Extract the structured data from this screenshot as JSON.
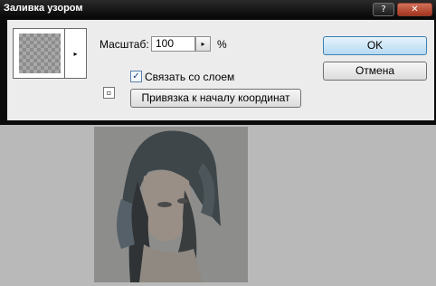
{
  "dialog": {
    "title": "Заливка узором",
    "help_glyph": "?",
    "close_glyph": "✕"
  },
  "pattern_picker": {
    "arrow_glyph": "▸"
  },
  "scale": {
    "label": "Масштаб:",
    "value": "100",
    "arrow_glyph": "▸",
    "unit": "%"
  },
  "link_layer": {
    "checked": true,
    "check_glyph": "✓",
    "label": "Связать со слоем"
  },
  "snap_button_label": "Привязка к началу координат",
  "new_preset_glyph": "▫",
  "buttons": {
    "ok": "OK",
    "cancel": "Отмена"
  }
}
